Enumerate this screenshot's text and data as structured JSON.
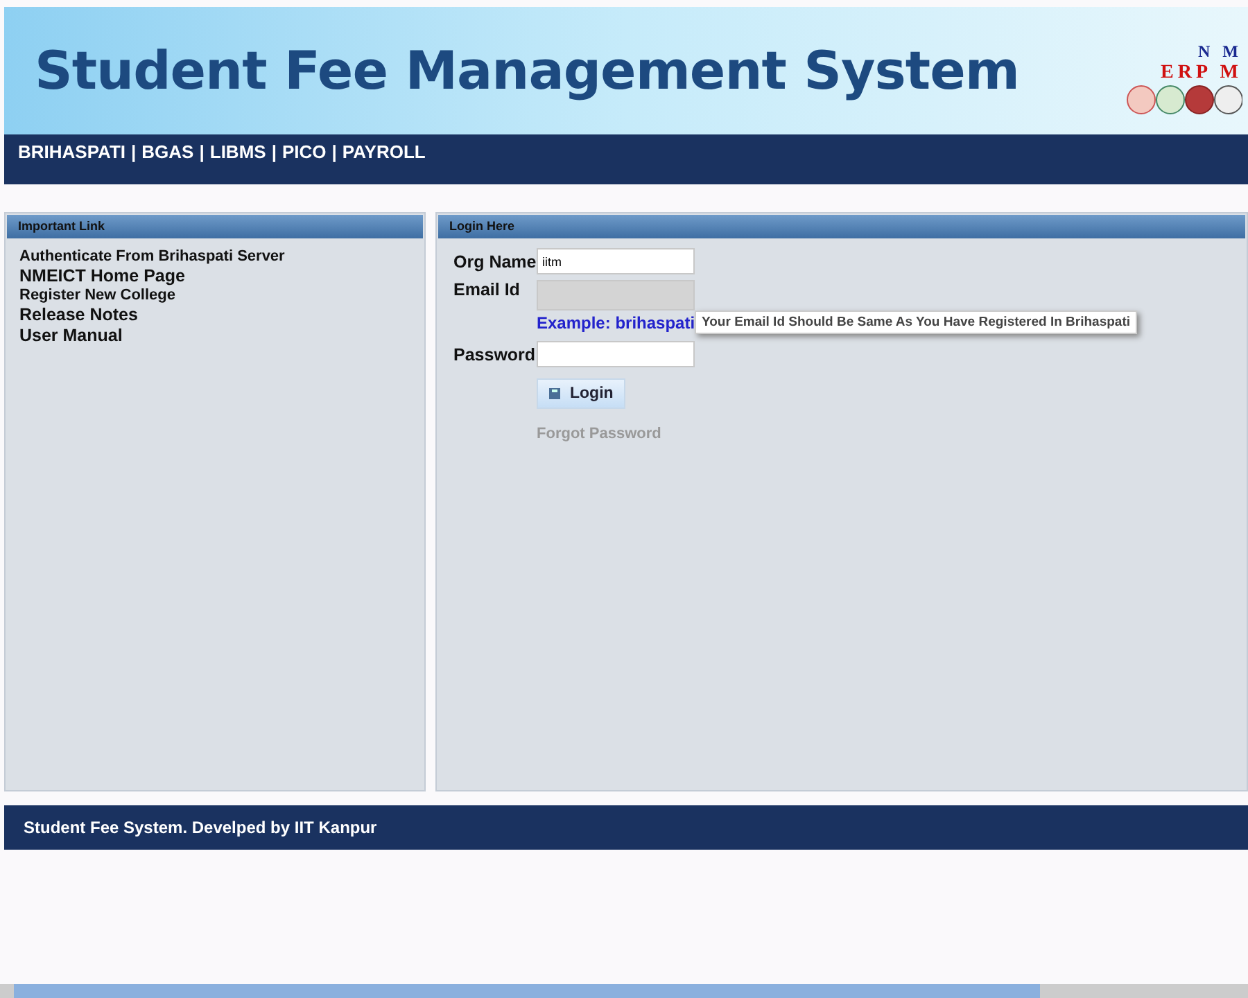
{
  "header": {
    "title": "Student Fee Management System",
    "logo_lines": [
      "N M",
      "ERP M"
    ]
  },
  "nav": {
    "separator": "|",
    "links": [
      "BRIHASPATI",
      "BGAS",
      "LIBMS",
      "PICO",
      "PAYROLL"
    ]
  },
  "important_links": {
    "title": "Important Link",
    "items": [
      {
        "label": "Authenticate From Brihaspati Server",
        "kind": "small"
      },
      {
        "label": "NMEICT Home Page",
        "kind": "large"
      },
      {
        "label": "Register New College",
        "kind": "small"
      },
      {
        "label": "Release Notes",
        "kind": "large"
      },
      {
        "label": "User Manual",
        "kind": "large"
      }
    ]
  },
  "login": {
    "title": "Login Here",
    "org_name": {
      "label": "Org Name",
      "value": "iitm"
    },
    "email": {
      "label": "Email Id",
      "disabled": true,
      "example": "Example: brihaspati"
    },
    "password": {
      "label": "Password"
    },
    "tooltip": "Your Email Id Should Be Same As You Have Registered In Brihaspati",
    "button": "Login",
    "forgot": "Forgot Password"
  },
  "footer": "Student Fee System. Develped by IIT Kanpur"
}
